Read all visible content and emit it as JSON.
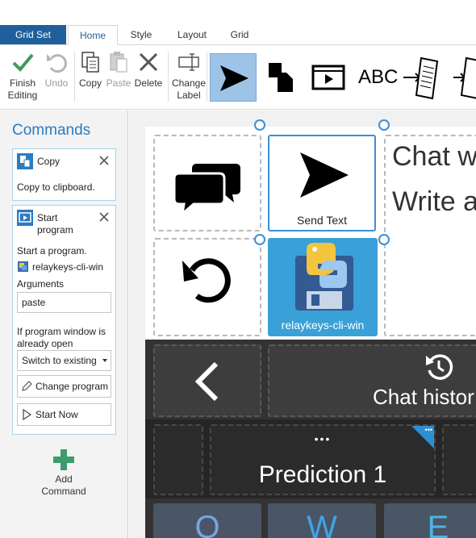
{
  "tabs": [
    "Grid Set",
    "Home",
    "Style",
    "Layout",
    "Grid"
  ],
  "toolbar": {
    "finish_editing": "Finish\nEditing",
    "undo": "Undo",
    "copy": "Copy",
    "paste": "Paste",
    "delete": "Delete",
    "change_label": "Change\nLabel",
    "abc": "ABC"
  },
  "panel": {
    "title": "Commands",
    "copy_card": {
      "title": "Copy",
      "description": "Copy to clipboard."
    },
    "start_card": {
      "title": "Start\nprogram",
      "description": "Start a program.",
      "program_name": "relaykeys-cli-win",
      "arguments_label": "Arguments",
      "arguments_value": "paste",
      "if_open_label": "If program window is already open",
      "if_open_value": "Switch to existing",
      "change_program_button": "Change program",
      "start_now_button": "Start Now"
    },
    "add_command": "Add\nCommand"
  },
  "grid": {
    "send_text_label": "Send Text",
    "program_label": "relaykeys-cli-win",
    "chat_line1": "Chat w",
    "chat_line2": "Write a",
    "chat_history": "Chat histor",
    "prediction_dots": "•••",
    "prediction_label": "Prediction 1",
    "corner_dots": "•••",
    "keys": [
      "Q",
      "W",
      "E"
    ]
  },
  "colors": {
    "accent": "#1f5f9b",
    "selection": "#3d8fd6",
    "key_q": "#4a6fb0",
    "key_w": "#2e8ed1",
    "key_e": "#3da9d6"
  }
}
